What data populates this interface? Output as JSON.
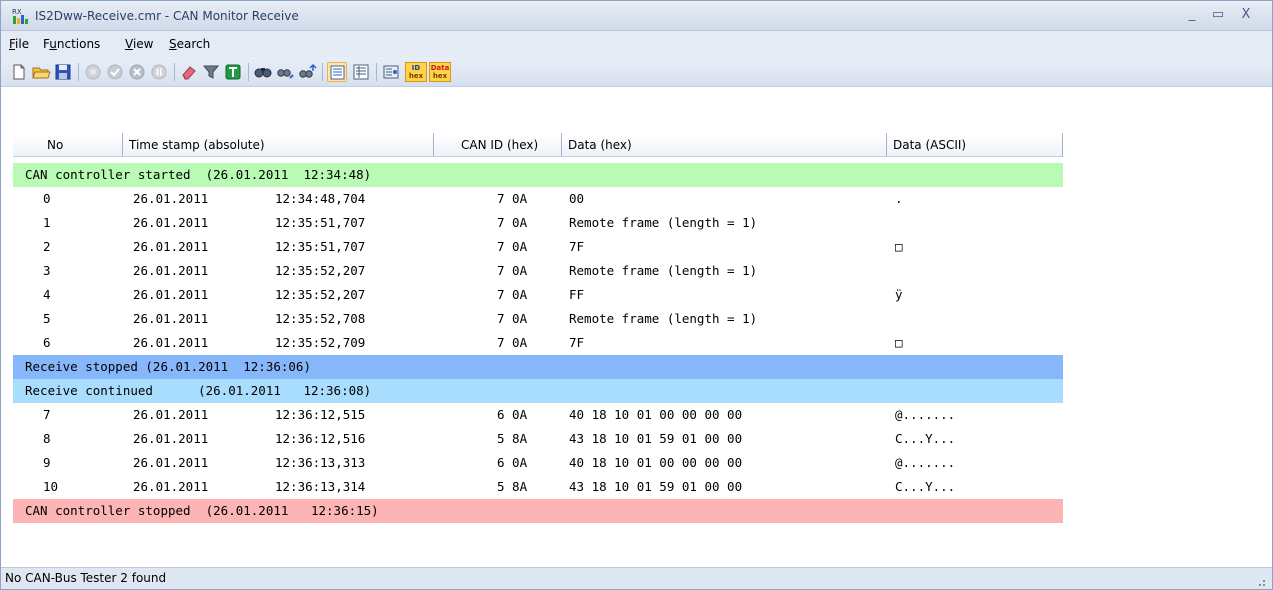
{
  "window": {
    "title": "IS2Dww-Receive.cmr - CAN Monitor Receive",
    "icon_label": "RX",
    "minimize_glyph": "_",
    "maximize_glyph": "▭",
    "close_glyph": "X"
  },
  "menu": [
    {
      "label": "File",
      "key": "F",
      "rest": "ile"
    },
    {
      "label": "Functions",
      "key": "u",
      "pre": "F",
      "rest": "nctions"
    },
    {
      "label": "View",
      "key": "V",
      "rest": "iew"
    },
    {
      "label": "Search",
      "key": "S",
      "rest": "earch"
    }
  ],
  "toolbar": {
    "icons": [
      "new-icon",
      "open-folder-icon",
      "save-icon",
      "record-disabled-icon",
      "check-disabled-icon",
      "stop-disabled-icon",
      "pause-disabled-icon",
      "eraser-icon",
      "filter-icon",
      "trigger-icon",
      "find-icon",
      "find-previous-icon",
      "find-next-icon",
      "view-list-icon",
      "view-detail-icon",
      "settings-icon"
    ],
    "id_hex": {
      "top": "ID",
      "bottom": "hex"
    },
    "data_hex": {
      "top": "Data",
      "bottom": "hex"
    }
  },
  "columns": [
    "No",
    "Time stamp (absolute)",
    "CAN ID (hex)",
    "Data (hex)",
    "Data (ASCII)"
  ],
  "rows": [
    {
      "type": "status",
      "color": "#b9fbb4",
      "text": "CAN controller started  (26.01.2011  12:34:48)"
    },
    {
      "type": "data",
      "no": "0",
      "date": "26.01.2011",
      "time": "12:34:48,704",
      "id": "7 0A",
      "data": "00",
      "ascii": "."
    },
    {
      "type": "data",
      "no": "1",
      "date": "26.01.2011",
      "time": "12:35:51,707",
      "id": "7 0A",
      "data": "Remote frame (length = 1)",
      "ascii": ""
    },
    {
      "type": "data",
      "no": "2",
      "date": "26.01.2011",
      "time": "12:35:51,707",
      "id": "7 0A",
      "data": "7F",
      "ascii": "□"
    },
    {
      "type": "data",
      "no": "3",
      "date": "26.01.2011",
      "time": "12:35:52,207",
      "id": "7 0A",
      "data": "Remote frame (length = 1)",
      "ascii": ""
    },
    {
      "type": "data",
      "no": "4",
      "date": "26.01.2011",
      "time": "12:35:52,207",
      "id": "7 0A",
      "data": "FF",
      "ascii": "ÿ"
    },
    {
      "type": "data",
      "no": "5",
      "date": "26.01.2011",
      "time": "12:35:52,708",
      "id": "7 0A",
      "data": "Remote frame (length = 1)",
      "ascii": ""
    },
    {
      "type": "data",
      "no": "6",
      "date": "26.01.2011",
      "time": "12:35:52,709",
      "id": "7 0A",
      "data": "7F",
      "ascii": "□"
    },
    {
      "type": "status",
      "color": "#86b7fb",
      "text": "Receive stopped (26.01.2011  12:36:06)"
    },
    {
      "type": "status",
      "color": "#a9ddfe",
      "text": "Receive continued      (26.01.2011   12:36:08)"
    },
    {
      "type": "data",
      "no": "7",
      "date": "26.01.2011",
      "time": "12:36:12,515",
      "id": "6 0A",
      "data": "40 18 10 01 00 00 00 00",
      "ascii": "@......."
    },
    {
      "type": "data",
      "no": "8",
      "date": "26.01.2011",
      "time": "12:36:12,516",
      "id": "5 8A",
      "data": "43 18 10 01 59 01 00 00",
      "ascii": "C...Y..."
    },
    {
      "type": "data",
      "no": "9",
      "date": "26.01.2011",
      "time": "12:36:13,313",
      "id": "6 0A",
      "data": "40 18 10 01 00 00 00 00",
      "ascii": "@......."
    },
    {
      "type": "data",
      "no": "10",
      "date": "26.01.2011",
      "time": "12:36:13,314",
      "id": "5 8A",
      "data": "43 18 10 01 59 01 00 00",
      "ascii": "C...Y..."
    },
    {
      "type": "status",
      "color": "#fcb4b4",
      "text": "CAN controller stopped  (26.01.2011   12:36:15)"
    }
  ],
  "statusbar": {
    "text": "No CAN-Bus Tester 2 found"
  }
}
